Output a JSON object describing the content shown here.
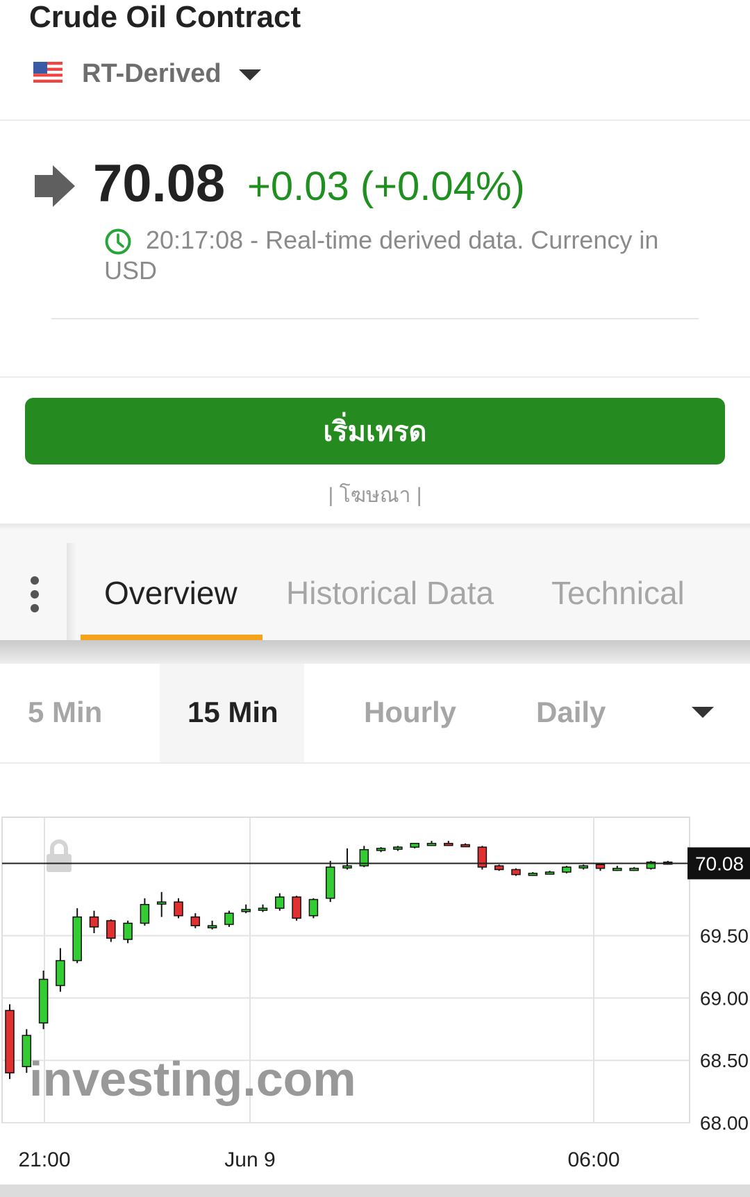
{
  "header": {
    "title": "Crude Oil Contract",
    "exchange": "RT-Derived",
    "flag_icon": "us-flag-icon"
  },
  "quote": {
    "price": "70.08",
    "change": "+0.03 (+0.04%)",
    "timestamp_text": "20:17:08 - Real-time derived data. Currency in USD",
    "arrow_icon": "arrow-right-icon",
    "clock_icon": "clock-icon",
    "change_color": "#1f8f1f"
  },
  "trade": {
    "button_label": "เริ่มเทรด",
    "ad_label": "| โฆษณา |",
    "button_color": "#258a1f"
  },
  "tabs": [
    {
      "label": "Overview",
      "active": true
    },
    {
      "label": "Historical Data",
      "active": false
    },
    {
      "label": "Technical",
      "active": false
    }
  ],
  "intervals": [
    {
      "label": "5 Min",
      "active": false
    },
    {
      "label": "15 Min",
      "active": true
    },
    {
      "label": "Hourly",
      "active": false
    },
    {
      "label": "Daily",
      "active": false
    }
  ],
  "accent_color": "#f5a31a",
  "chart_data": {
    "type": "candlestick",
    "y_ticks": [
      "70.08",
      "69.50",
      "69.00",
      "68.50",
      "68.00"
    ],
    "x_ticks": [
      "21:00",
      "Jun 9",
      "06:00"
    ],
    "ylim": [
      68.0,
      70.45
    ],
    "current_price": 70.08,
    "current_price_label": "70.08",
    "watermark": "investing.com",
    "up_color": "#33cc33",
    "down_color": "#e03030",
    "candles": [
      {
        "o": 68.9,
        "h": 68.95,
        "l": 68.35,
        "c": 68.4
      },
      {
        "o": 68.45,
        "h": 68.75,
        "l": 68.4,
        "c": 68.7
      },
      {
        "o": 68.8,
        "h": 69.22,
        "l": 68.75,
        "c": 69.15
      },
      {
        "o": 69.1,
        "h": 69.4,
        "l": 69.05,
        "c": 69.3
      },
      {
        "o": 69.3,
        "h": 69.72,
        "l": 69.28,
        "c": 69.65
      },
      {
        "o": 69.65,
        "h": 69.7,
        "l": 69.52,
        "c": 69.57
      },
      {
        "o": 69.62,
        "h": 69.63,
        "l": 69.45,
        "c": 69.48
      },
      {
        "o": 69.47,
        "h": 69.62,
        "l": 69.44,
        "c": 69.6
      },
      {
        "o": 69.6,
        "h": 69.8,
        "l": 69.58,
        "c": 69.75
      },
      {
        "o": 69.76,
        "h": 69.85,
        "l": 69.65,
        "c": 69.77
      },
      {
        "o": 69.77,
        "h": 69.8,
        "l": 69.64,
        "c": 69.66
      },
      {
        "o": 69.65,
        "h": 69.68,
        "l": 69.56,
        "c": 69.58
      },
      {
        "o": 69.57,
        "h": 69.62,
        "l": 69.55,
        "c": 69.58
      },
      {
        "o": 69.59,
        "h": 69.7,
        "l": 69.57,
        "c": 69.68
      },
      {
        "o": 69.7,
        "h": 69.75,
        "l": 69.68,
        "c": 69.71
      },
      {
        "o": 69.71,
        "h": 69.75,
        "l": 69.69,
        "c": 69.72
      },
      {
        "o": 69.72,
        "h": 69.84,
        "l": 69.7,
        "c": 69.81
      },
      {
        "o": 69.81,
        "h": 69.82,
        "l": 69.62,
        "c": 69.64
      },
      {
        "o": 69.66,
        "h": 69.8,
        "l": 69.64,
        "c": 69.79
      },
      {
        "o": 69.8,
        "h": 70.1,
        "l": 69.77,
        "c": 70.05
      },
      {
        "o": 70.05,
        "h": 70.2,
        "l": 70.03,
        "c": 70.06
      },
      {
        "o": 70.06,
        "h": 70.22,
        "l": 70.05,
        "c": 70.19
      },
      {
        "o": 70.19,
        "h": 70.21,
        "l": 70.17,
        "c": 70.2
      },
      {
        "o": 70.2,
        "h": 70.22,
        "l": 70.18,
        "c": 70.21
      },
      {
        "o": 70.21,
        "h": 70.24,
        "l": 70.2,
        "c": 70.24
      },
      {
        "o": 70.24,
        "h": 70.26,
        "l": 70.22,
        "c": 70.24
      },
      {
        "o": 70.24,
        "h": 70.26,
        "l": 70.22,
        "c": 70.23
      },
      {
        "o": 70.23,
        "h": 70.24,
        "l": 70.22,
        "c": 70.22
      },
      {
        "o": 70.21,
        "h": 70.22,
        "l": 70.03,
        "c": 70.05
      },
      {
        "o": 70.06,
        "h": 70.07,
        "l": 70.02,
        "c": 70.03
      },
      {
        "o": 70.03,
        "h": 70.04,
        "l": 69.98,
        "c": 69.99
      },
      {
        "o": 70.0,
        "h": 70.01,
        "l": 69.99,
        "c": 70.0
      },
      {
        "o": 70.01,
        "h": 70.02,
        "l": 70.0,
        "c": 70.01
      },
      {
        "o": 70.01,
        "h": 70.06,
        "l": 70.0,
        "c": 70.05
      },
      {
        "o": 70.05,
        "h": 70.07,
        "l": 70.03,
        "c": 70.06
      },
      {
        "o": 70.07,
        "h": 70.08,
        "l": 70.02,
        "c": 70.04
      },
      {
        "o": 70.04,
        "h": 70.06,
        "l": 70.02,
        "c": 70.04
      },
      {
        "o": 70.04,
        "h": 70.05,
        "l": 70.02,
        "c": 70.04
      },
      {
        "o": 70.04,
        "h": 70.1,
        "l": 70.03,
        "c": 70.09
      },
      {
        "o": 70.09,
        "h": 70.1,
        "l": 70.07,
        "c": 70.08
      }
    ]
  }
}
